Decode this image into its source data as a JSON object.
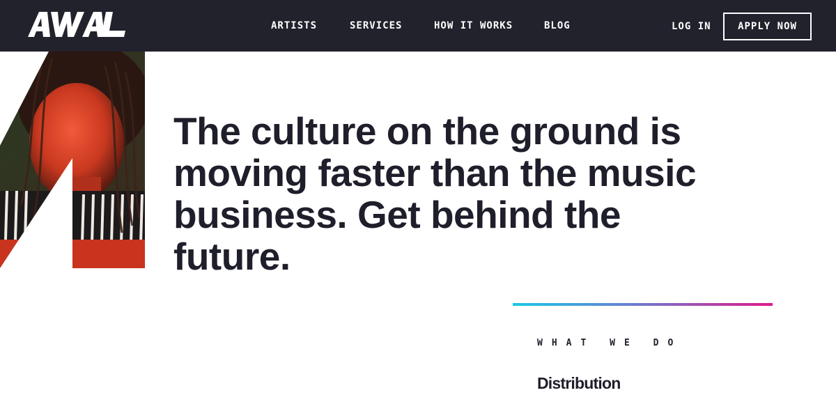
{
  "header": {
    "logo_text": "AWAL",
    "nav": [
      {
        "label": "ARTISTS"
      },
      {
        "label": "SERVICES"
      },
      {
        "label": "HOW IT WORKS"
      },
      {
        "label": "BLOG"
      }
    ],
    "login_label": "LOG IN",
    "apply_label": "APPLY NOW"
  },
  "hero": {
    "headline": "The culture on the ground is moving faster than the music business. Get behind the future."
  },
  "section": {
    "kicker": "WHAT WE DO",
    "title": "Distribution"
  },
  "colors": {
    "nav_bg": "#22222d",
    "text_dark": "#1f1f2b",
    "gradient_start": "#19c8e6",
    "gradient_end": "#e0198c"
  }
}
